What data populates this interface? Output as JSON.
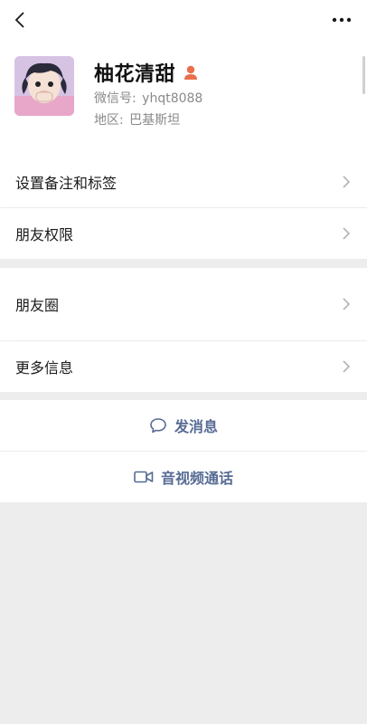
{
  "header": {
    "back_icon": "chevron-left-icon",
    "more_icon": "more-dots-icon"
  },
  "profile": {
    "name": "柚花清甜",
    "gender_icon": "female-icon",
    "gender_color": "#e9704b",
    "wechat_id_label": "微信号:",
    "wechat_id": "yhqt8088",
    "region_label": "地区:",
    "region": "巴基斯坦"
  },
  "menu_group_1": [
    {
      "label": "设置备注和标签"
    },
    {
      "label": "朋友权限"
    }
  ],
  "menu_group_2": [
    {
      "label": "朋友圈"
    },
    {
      "label": "更多信息"
    }
  ],
  "actions": {
    "message_label": "发消息",
    "video_call_label": "音视频通话",
    "accent_color": "#576b95"
  }
}
